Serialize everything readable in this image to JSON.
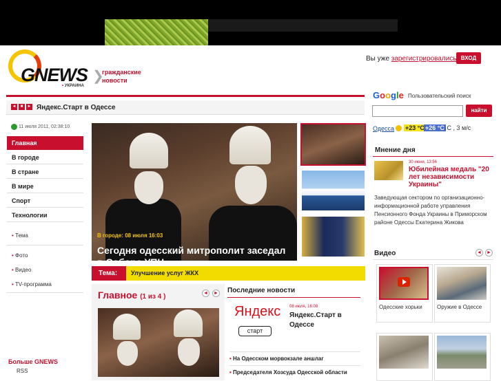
{
  "header": {
    "logo_text": "GNEWS",
    "logo_sub": "УКРАИНА",
    "civic_label": "гражданские новости",
    "login_question": "Вы уже ",
    "login_link": "зарегистрировались",
    "login_q_mark": "?",
    "login_button": "ВХОД"
  },
  "search": {
    "google_label": "Пользовательский поиск",
    "button": "найти"
  },
  "ticker": {
    "text": "Яндекс.Старт в Одессе",
    "buttons": [
      "◄",
      "■",
      "►"
    ]
  },
  "weather": {
    "city": "Одесса",
    "temp1": "+23 °C",
    "temp2": "+26 °C",
    "wind": "↓С , 3 м/с"
  },
  "sidebar": {
    "date": "11 июля 2011, 02:38:10",
    "menu": [
      "Главная",
      "В городе",
      "В стране",
      "В мире",
      "Спорт",
      "Технологии"
    ],
    "sub1": [
      "Тема"
    ],
    "sub2": [
      "Фото",
      "Видео",
      "TV-программа"
    ],
    "more": "Больше GNEWS",
    "rss": "RSS"
  },
  "feature": {
    "category": "В городе: 08 июля 16:03",
    "headline": "Сегодня одесский митрополит заседал в Соборе УПЦ"
  },
  "tema": {
    "label": "Тема:",
    "text": "Улучшение услуг ЖКХ"
  },
  "main_block": {
    "title": "Главное",
    "counter": "(1 из 4 )",
    "prev": "◄",
    "next": "►"
  },
  "latest": {
    "title": "Последние новости",
    "yandex_word_red": "Я",
    "yandex_word": "ндекс",
    "yandex_start": "старт",
    "first_date": "08 июля, 16:08",
    "first_head": "Яндекс.Старт в Одессе",
    "items": [
      "На Одесском морвокзале аншлаг",
      "Председателя Хозсуда Одесской области"
    ]
  },
  "opinion": {
    "title": "Мнение дня",
    "date": "30 июня, 13:56",
    "headline": "Юбилейная медаль \"20 лет независимости Украины\"",
    "text": "Заведующая сектором по организационно-информационной работе управления Пенсионного Фонда Украины в Приморском районе Одессы Екатерина Жикова"
  },
  "video": {
    "title": "Видео",
    "prev": "◄",
    "next": "►",
    "items": [
      "Одесские хорьки",
      "Оружие в Одессе"
    ]
  }
}
